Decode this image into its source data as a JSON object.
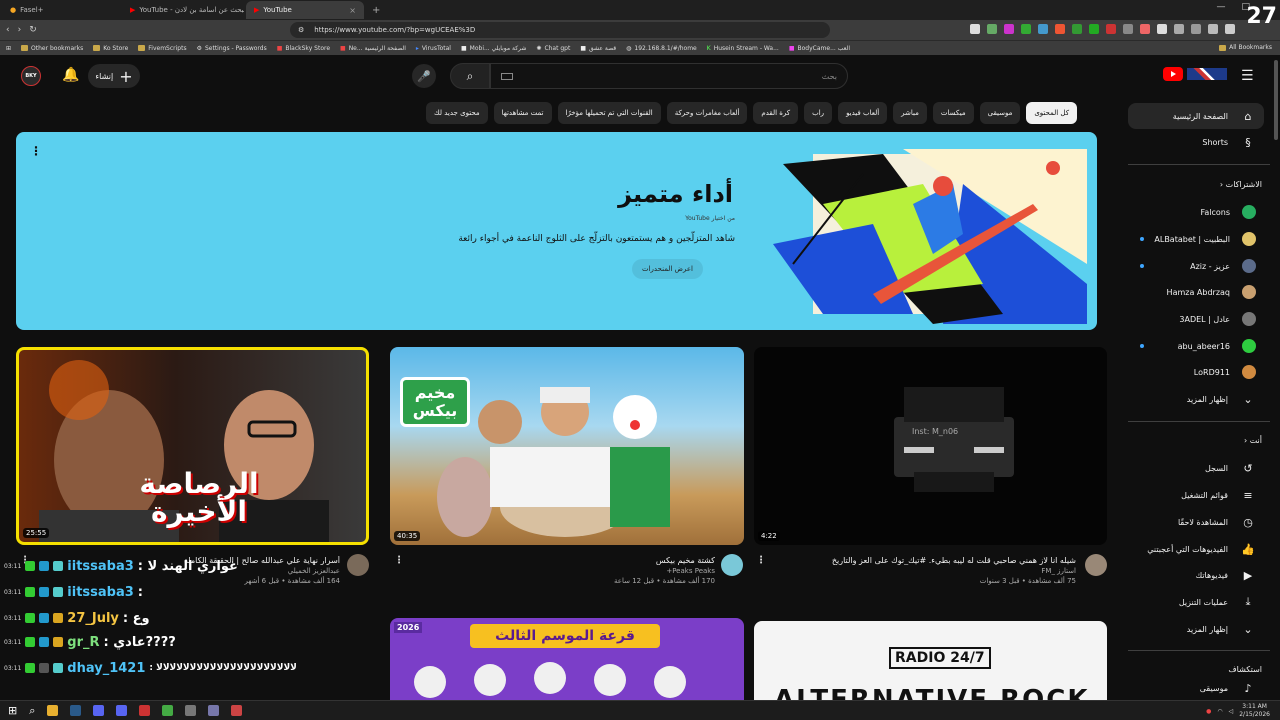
{
  "browser": {
    "tabs": [
      {
        "label": "Fasel+",
        "active": false
      },
      {
        "label": "YouTube - رحلة البحث عن اسامة بن لادن",
        "active": false
      },
      {
        "label": "YouTube",
        "active": true
      }
    ],
    "url": "https://www.youtube.com/?bp=wgUCEAE%3D",
    "bookmarks": [
      "Other bookmarks",
      "Ko Store",
      "FivemScripts",
      "Settings - Passwords",
      "BlackSky Store",
      "Ne... الصفحة الرئيسية",
      "VirusTotal",
      "Mobi... شركة موبايلي",
      "Chat gpt",
      "قصة عشق",
      "192.168.8.1/#/home",
      "Husein Stream - Wa...",
      "BodyCame... العب"
    ],
    "all_bookmarks": "All Bookmarks",
    "overlay_number": "27"
  },
  "header": {
    "avatar_text": "BKY",
    "create_label": "إنشاء",
    "search_placeholder": "بحث"
  },
  "chips": [
    "كل المحتوى",
    "موسيقى",
    "ميكسات",
    "مباشر",
    "ألعاب فيديو",
    "راب",
    "كرة القدم",
    "ألعاب مغامرات وحركة",
    "القنوات التي تم تحميلها مؤخرًا",
    "تمت مشاهدتها",
    "محتوى جديد لك"
  ],
  "banner": {
    "title": "أداء متميز",
    "from": "من اختيار YouTube",
    "description": "شاهد المتزلّجين و هم يستمتعون بالتزلّج على الثلوج الناعمة في أجواء رائعة",
    "button": "اعرض المنحدرات",
    "colors": {
      "bg": "#5bd0ef"
    }
  },
  "videos": [
    {
      "title": "أسرار نهاية علي عبدالله صالح | الحقيقة الكاملة",
      "channel": "عبدالعزيز الخميلي",
      "meta": "164 ألف مشاهدة • قبل 6 أشهر",
      "duration": "25:55",
      "thumb_text": "الرصاصة الأخيرة"
    },
    {
      "title": "كشتة مخيم بيكس",
      "channel": "Peaks",
      "channel_handle": "Peaks+",
      "meta": "170 ألف مشاهدة • قبل 12 ساعة",
      "duration": "40:35",
      "thumb_text": "مخيم بيكس"
    },
    {
      "title": "شيله انا لاز همني صاحبي قلت له ليبه بطيء. #تيك_توك على العز والتاريخ",
      "channel": "استارز _FM",
      "meta": "75 ألف مشاهدة • قبل 3 سنوات",
      "duration": "4:22",
      "thumb_text": "Inst: M_n06"
    },
    {
      "thumb_text": "قرعة الموسم الثالث",
      "badge": "2026"
    },
    {
      "thumb_text": "RADIO 24/7",
      "sub_text": "ALTERNATIVE ROCK"
    }
  ],
  "sidebar": {
    "home": "الصفحة الرئيسية",
    "shorts": "Shorts",
    "subs_title": "الاشتراكات",
    "subscriptions": [
      {
        "name": "Falcons",
        "live": false,
        "color": "#27ae60"
      },
      {
        "name": "البطبيت | ALBatabet",
        "live": true,
        "color": "#e0c36a"
      },
      {
        "name": "عزيز - Aziz",
        "live": true,
        "color": "#5b6b8a"
      },
      {
        "name": "Hamza Abdrzaq",
        "live": false,
        "color": "#c9a070"
      },
      {
        "name": "عادل | 3ADEL",
        "live": false,
        "color": "#777"
      },
      {
        "name": "abu_abeer16",
        "live": true,
        "color": "#2ecc40"
      },
      {
        "name": "LoRD911",
        "live": false,
        "color": "#d08a40"
      }
    ],
    "show_more_1": "إظهار المزيد",
    "you_title": "أنت",
    "you_items": [
      {
        "label": "السجل",
        "icon": "history-icon",
        "glyph": "↺"
      },
      {
        "label": "قوائم التشغيل",
        "icon": "playlist-icon",
        "glyph": "≡"
      },
      {
        "label": "المشاهدة لاحقًا",
        "icon": "clock-icon",
        "glyph": "◷"
      },
      {
        "label": "الفيديوهات التي أعجبتني",
        "icon": "like-icon",
        "glyph": "👍"
      },
      {
        "label": "فيديوهاتك",
        "icon": "video-icon",
        "glyph": "▶"
      },
      {
        "label": "عمليات التنزيل",
        "icon": "download-icon",
        "glyph": "⤓"
      }
    ],
    "show_more_2": "إظهار المزيد",
    "explore_title": "استكشاف",
    "explore_items": [
      {
        "label": "موسيقى",
        "icon": "music-icon",
        "glyph": "♪"
      }
    ]
  },
  "chat": [
    {
      "time": "03:11",
      "user": "iitssaba3",
      "msg": ": غواري الهند لا"
    },
    {
      "time": "03:11",
      "user": "iitssaba3",
      "msg": ":"
    },
    {
      "time": "03:11",
      "user": "27_July",
      "msg": ": وع"
    },
    {
      "time": "03:11",
      "user": "gr_R",
      "msg": ": عادي????"
    },
    {
      "time": "03:11",
      "user": "dhay_1421",
      "msg": ": ﻻﻻﻻﻻﻻﻻﻻﻻﻻﻻﻻﻻﻻﻻﻻﻻﻻﻻﻻﻻﻻ"
    }
  ],
  "taskbar": {
    "time": "3:11 AM",
    "date": "2/15/2026"
  }
}
